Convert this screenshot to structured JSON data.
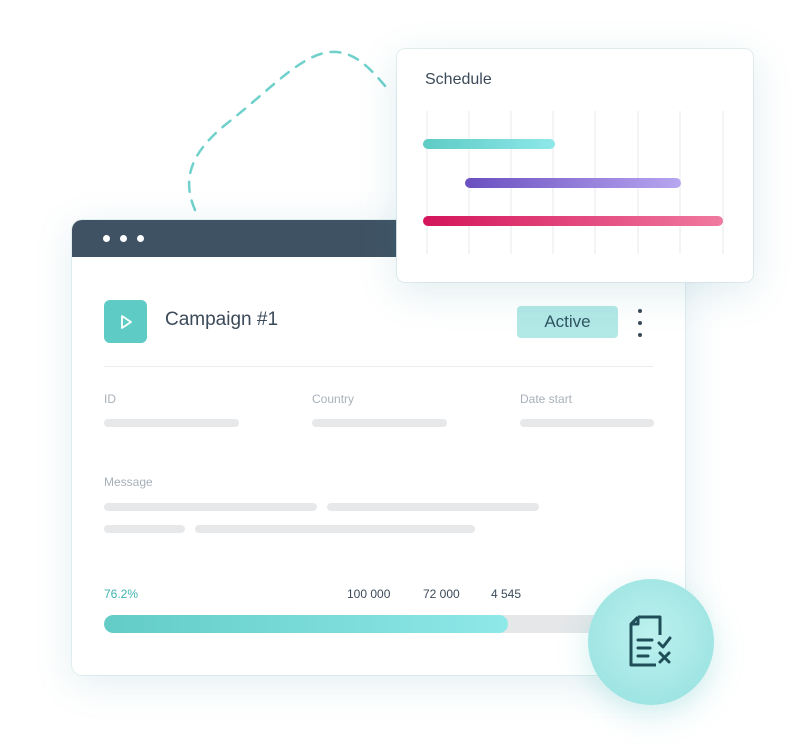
{
  "campaign": {
    "title": "Campaign #1",
    "status": "Active",
    "fields": [
      {
        "label": "ID"
      },
      {
        "label": "Country"
      },
      {
        "label": "Date start"
      }
    ],
    "message_label": "Message",
    "progress": {
      "percent_label": "76.2%",
      "fraction": 0.762,
      "stats": [
        "100 000",
        "72 000",
        "4 545"
      ]
    }
  },
  "schedule": {
    "title": "Schedule",
    "bars": [
      {
        "start": 0.0,
        "end": 0.44,
        "color_from": "#5ecbc5",
        "color_to": "#8ee8ea"
      },
      {
        "start": 0.14,
        "end": 0.86,
        "color_from": "#6a4fc0",
        "color_to": "#b7a6f0"
      },
      {
        "start": 0.0,
        "end": 1.0,
        "color_from": "#d4145a",
        "color_to": "#f07aa0"
      }
    ]
  },
  "colors": {
    "accent": "#5ecbc5",
    "titlebar": "#3f5263",
    "text": "#3b4a59"
  },
  "icons": {
    "window_controls": "dots",
    "play": "play-icon",
    "more": "more-vertical-icon",
    "document": "document-check-icon"
  }
}
